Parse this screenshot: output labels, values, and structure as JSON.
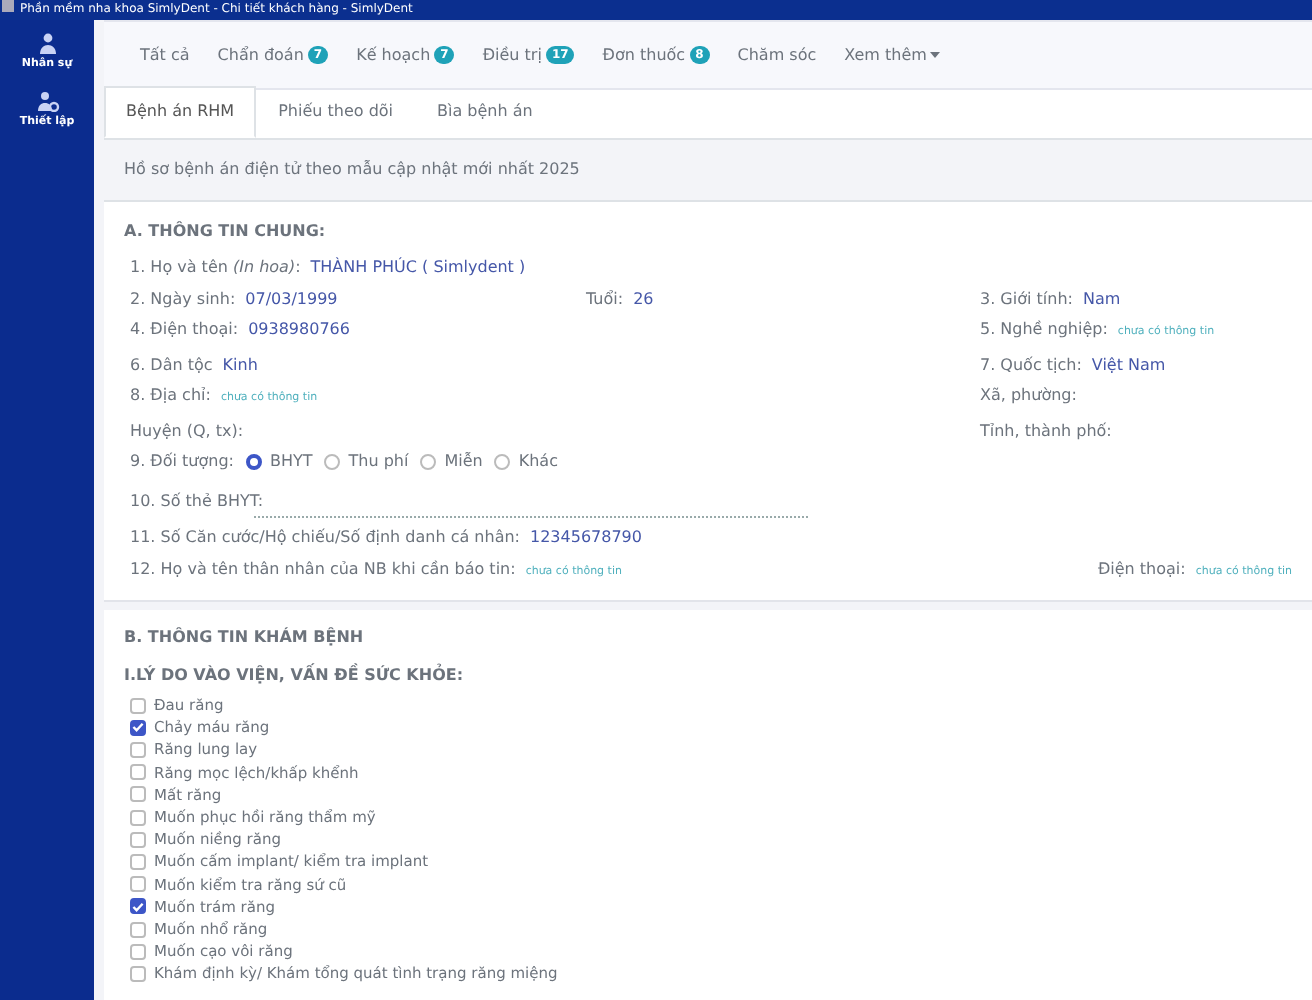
{
  "window": {
    "title": "Phần mềm nha khoa SimlyDent - Chi tiết khách hàng - SimlyDent"
  },
  "sidebar": {
    "items": [
      {
        "label": "Nhân sự",
        "kind": "person"
      },
      {
        "label": "Thiết lập",
        "kind": "people"
      }
    ]
  },
  "tabs": [
    {
      "label": "Tất cả",
      "selected": false,
      "kind": "link"
    },
    {
      "label": "Chẩn đoán",
      "badge": "7",
      "selected": false,
      "kind": "link"
    },
    {
      "label": "Kế hoạch",
      "badge": "7",
      "selected": false,
      "kind": "link"
    },
    {
      "label": "Điều trị",
      "badge": "17",
      "selected": false,
      "kind": "link"
    },
    {
      "label": "Đơn thuốc",
      "badge": "8",
      "selected": false,
      "kind": "link"
    },
    {
      "label": "Chăm sóc",
      "selected": false,
      "kind": "link"
    },
    {
      "label": "Xem thêm",
      "selected": false,
      "kind": "dropdown"
    }
  ],
  "subtabs": [
    {
      "label": "Bệnh án RHM",
      "selected": true
    },
    {
      "label": "Phiếu theo dõi",
      "selected": false
    },
    {
      "label": "Bìa bệnh án",
      "selected": false
    }
  ],
  "header": {
    "text": "Hồ sơ bệnh án điện tử theo mẫu cập nhật mới nhất 2025"
  },
  "section_a": {
    "title": "A. THÔNG TIN CHUNG:",
    "rows": [
      {
        "kind": "fields",
        "left": {
          "label": "1. Họ và tên *(In hoa)*:",
          "value": "THÀNH PHÚC ( Simlydent )",
          "kind": "value"
        }
      },
      {
        "kind": "fields",
        "left": {
          "label": "2. Ngày sinh:",
          "value": "07/03/1999",
          "kind": "value"
        },
        "middle": {
          "label": "Tuổi:",
          "value": "26",
          "kind": "value"
        },
        "right": {
          "label": "3. Giới tính:",
          "value": "Nam",
          "kind": "value"
        }
      },
      {
        "kind": "fields",
        "left": {
          "label": "4. Điện thoại:",
          "value": "0938980766",
          "kind": "value"
        },
        "right": {
          "label": "5. Nghề nghiệp:",
          "value": "chưa có thông tin",
          "kind": "missing"
        }
      },
      {
        "kind": "fields",
        "left": {
          "label": "6. Dân tộc",
          "value": "Kinh",
          "kind": "value"
        },
        "right": {
          "label": "7. Quốc tịch:",
          "value": "Việt Nam",
          "kind": "value"
        }
      },
      {
        "kind": "fields",
        "left": {
          "label": "8. Địa chỉ:",
          "value": "chưa có thông tin",
          "kind": "missing"
        },
        "right": {
          "label": "Xã, phường:",
          "kind": "label"
        }
      },
      {
        "kind": "fields",
        "left": {
          "label": "Huyện (Q, tx):",
          "kind": "label"
        },
        "right": {
          "label": "Tỉnh, thành phố:",
          "kind": "label"
        }
      },
      {
        "kind": "radios",
        "label": "9. Đối tượng:",
        "options": [
          {
            "label": "BHYT",
            "selected": true
          },
          {
            "label": "Thu phí",
            "selected": false
          },
          {
            "label": "Miễn",
            "selected": false
          },
          {
            "label": "Khác",
            "selected": false
          }
        ]
      },
      {
        "kind": "line",
        "label": "10. Số thẻ BHYT:"
      },
      {
        "kind": "fields",
        "left": {
          "label": "11. Số Căn cước/Hộ chiếu/Số định danh cá nhân:",
          "value": "12345678790",
          "kind": "value"
        }
      },
      {
        "kind": "fields",
        "left": {
          "label": "12. Họ và tên thân nhân của NB khi cần báo tin:",
          "value": "chưa có thông tin",
          "kind": "missing"
        },
        "far": {
          "label": "Điện thoại:",
          "value": "chưa có thông tin",
          "kind": "missing"
        }
      }
    ]
  },
  "section_b": {
    "title": "B. THÔNG TIN KHÁM BỆNH",
    "subtitle": "I.LÝ DO VÀO VIỆN, VẤN ĐỀ SỨC KHỎE:",
    "items": [
      {
        "label": "Đau răng",
        "checked": false
      },
      {
        "label": "Chảy máu răng",
        "checked": true
      },
      {
        "label": "Răng lung lay",
        "checked": false
      },
      {
        "label": "Răng mọc lệch/khấp khểnh",
        "checked": false
      },
      {
        "label": "Mất răng",
        "checked": false
      },
      {
        "label": "Muốn phục hồi răng thẩm mỹ",
        "checked": false
      },
      {
        "label": "Muốn niềng răng",
        "checked": false
      },
      {
        "label": "Muốn cấm implant/ kiểm tra implant",
        "checked": false
      },
      {
        "label": "Muốn kiểm tra răng sứ cũ",
        "checked": false
      },
      {
        "label": "Muốn trám răng",
        "checked": true
      },
      {
        "label": "Muốn nhổ răng",
        "checked": false
      },
      {
        "label": "Muốn cạo vôi răng",
        "checked": false
      },
      {
        "label": "Khám định kỳ/ Khám tổng quát tình trạng răng miệng",
        "checked": false
      }
    ]
  }
}
